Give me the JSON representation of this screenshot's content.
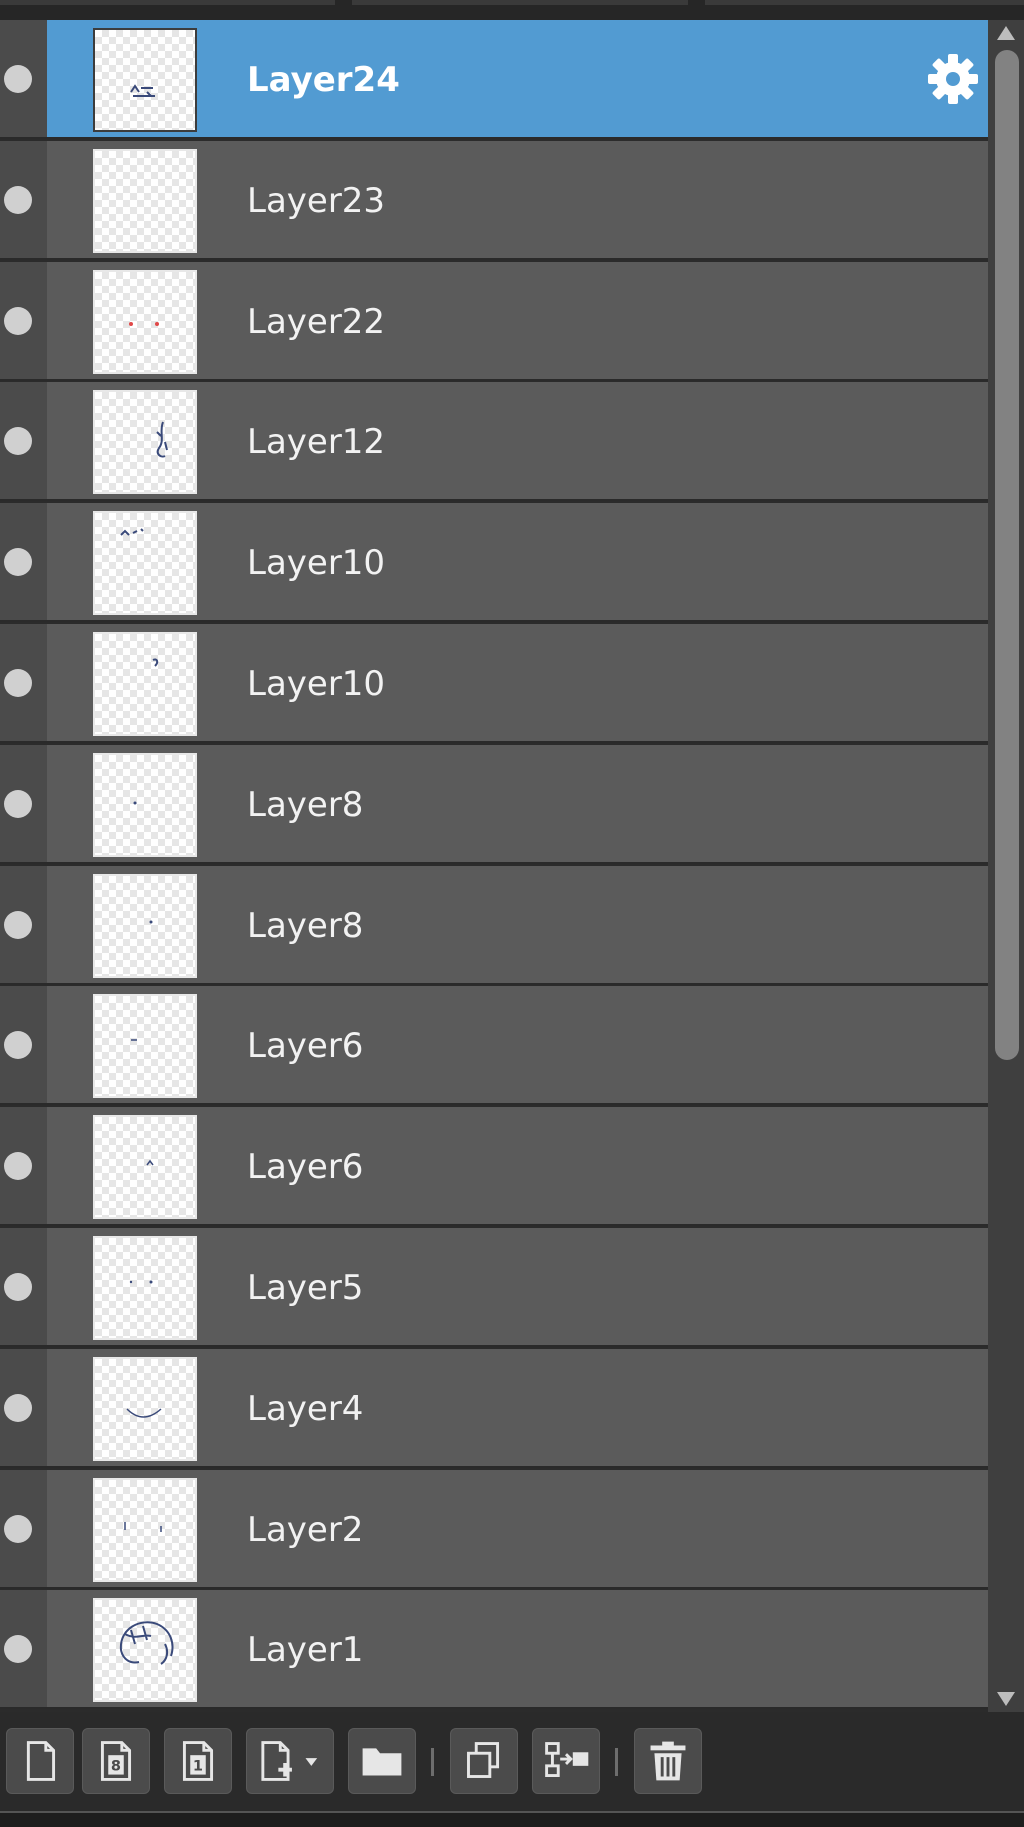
{
  "panel": {
    "type": "layer-panel"
  },
  "layers": [
    {
      "name": "Layer24",
      "selected": true,
      "thumb": "marks-center"
    },
    {
      "name": "Layer23",
      "selected": false,
      "thumb": "empty"
    },
    {
      "name": "Layer22",
      "selected": false,
      "thumb": "red-dots"
    },
    {
      "name": "Layer12",
      "selected": false,
      "thumb": "figure"
    },
    {
      "name": "Layer10",
      "selected": false,
      "thumb": "marks-top"
    },
    {
      "name": "Layer10",
      "selected": false,
      "thumb": "small-mark"
    },
    {
      "name": "Layer8",
      "selected": false,
      "thumb": "tiny-dot"
    },
    {
      "name": "Layer8",
      "selected": false,
      "thumb": "tiny-dot-right"
    },
    {
      "name": "Layer6",
      "selected": false,
      "thumb": "tiny-dash"
    },
    {
      "name": "Layer6",
      "selected": false,
      "thumb": "tiny-caret"
    },
    {
      "name": "Layer5",
      "selected": false,
      "thumb": "two-dots"
    },
    {
      "name": "Layer4",
      "selected": false,
      "thumb": "smile-curve"
    },
    {
      "name": "Layer2",
      "selected": false,
      "thumb": "two-ticks"
    },
    {
      "name": "Layer1",
      "selected": false,
      "thumb": "head-sketch"
    }
  ],
  "layer_settings_icon": "gear-icon",
  "toolbar": {
    "buttons": [
      {
        "icon": "new-layer-icon"
      },
      {
        "icon": "new-8bit-layer-icon",
        "glyph": "8"
      },
      {
        "icon": "new-1bit-layer-icon",
        "glyph": "1"
      },
      {
        "icon": "new-layer-menu-icon"
      },
      {
        "icon": "new-folder-icon"
      },
      {
        "icon": "duplicate-layer-icon"
      },
      {
        "icon": "merge-down-icon"
      },
      {
        "icon": "delete-layer-icon"
      }
    ]
  },
  "colors": {
    "selected_row": "#529bd2",
    "row": "#5b5b5b",
    "panel_background": "#2b2b2b",
    "sketch_ink": "#3a4a7a",
    "red_marks": "#e04848"
  }
}
